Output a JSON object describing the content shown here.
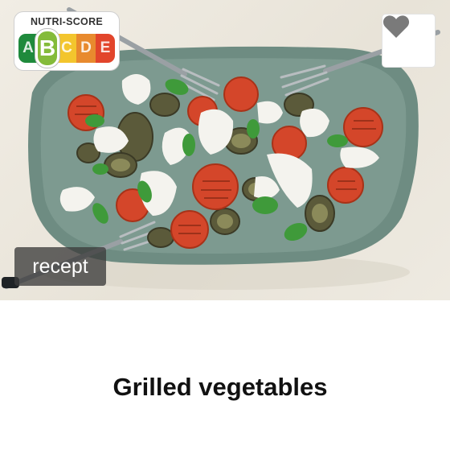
{
  "nutri_score": {
    "title": "NUTRI-SCORE",
    "grades": [
      {
        "letter": "A",
        "color": "#1f8a3c"
      },
      {
        "letter": "B",
        "color": "#84bb3a"
      },
      {
        "letter": "C",
        "color": "#f3c52d"
      },
      {
        "letter": "D",
        "color": "#e88a2e"
      },
      {
        "letter": "E",
        "color": "#e2452b"
      }
    ],
    "selected": "B"
  },
  "favorite": {
    "icon": "heart-icon",
    "color": "#7a7a7a"
  },
  "badge": {
    "label": "recept"
  },
  "recipe": {
    "title": "Grilled vegetables"
  }
}
